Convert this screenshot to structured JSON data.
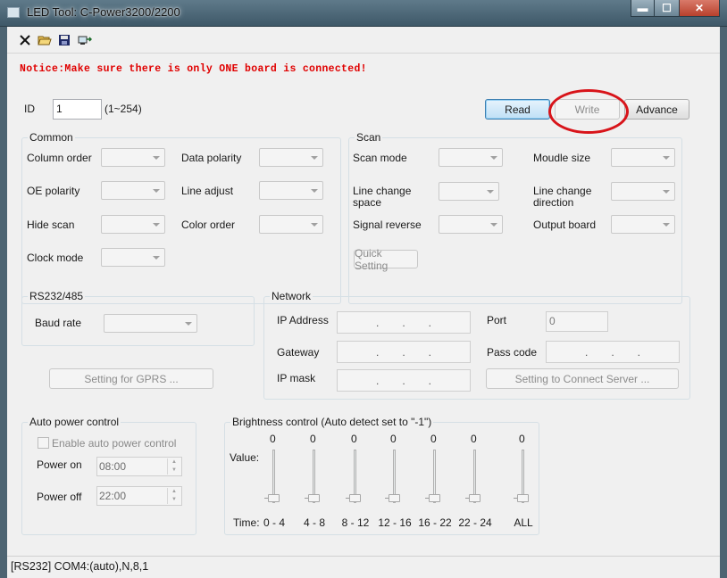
{
  "window": {
    "title": "LED Tool: C-Power3200/2200",
    "controls": {
      "minimize": "▬",
      "maximize": "☐",
      "close": "✕"
    }
  },
  "toolbar": {
    "icons": [
      "close-icon",
      "open-folder-icon",
      "save-icon",
      "connect-icon"
    ]
  },
  "notice": "Notice:Make sure there is only ONE board is connected!",
  "id_row": {
    "label": "ID",
    "value": "1",
    "range": "(1~254)"
  },
  "actions": {
    "read": "Read",
    "write": "Write",
    "advance": "Advance"
  },
  "common": {
    "title": "Common",
    "column_order": "Column order",
    "data_polarity": "Data polarity",
    "oe_polarity": "OE polarity",
    "line_adjust": "Line adjust",
    "hide_scan": "Hide scan",
    "color_order": "Color order",
    "clock_mode": "Clock mode"
  },
  "scan": {
    "title": "Scan",
    "scan_mode": "Scan mode",
    "moudle_size": "Moudle size",
    "line_change_space": "Line change space",
    "line_change_direction": "Line change direction",
    "signal_reverse": "Signal reverse",
    "output_board": "Output board",
    "quick_setting": "Quick Setting"
  },
  "rs232": {
    "title": "RS232/485",
    "baud_rate": "Baud rate",
    "gprs_button": "Setting for GPRS ..."
  },
  "network": {
    "title": "Network",
    "ip_address": "IP Address",
    "gateway": "Gateway",
    "ip_mask": "IP mask",
    "port_label": "Port",
    "port_value": "0",
    "pass_code": "Pass code",
    "connect_button": "Setting to Connect Server ..."
  },
  "auto_power": {
    "title": "Auto power control",
    "enable": "Enable auto power control",
    "power_on_label": "Power on",
    "power_on_value": "08:00",
    "power_off_label": "Power off",
    "power_off_value": "22:00"
  },
  "brightness": {
    "title": "Brightness control (Auto detect set to \"-1\")",
    "value_label": "Value:",
    "time_label": "Time:",
    "columns": [
      {
        "value": "0",
        "time": "0 - 4"
      },
      {
        "value": "0",
        "time": "4 - 8"
      },
      {
        "value": "0",
        "time": "8 - 12"
      },
      {
        "value": "0",
        "time": "12 - 16"
      },
      {
        "value": "0",
        "time": "16 - 22"
      },
      {
        "value": "0",
        "time": "22 - 24"
      },
      {
        "value": "0",
        "time": "ALL"
      }
    ]
  },
  "status_bar": "[RS232] COM4:(auto),N,8,1",
  "colors": {
    "notice": "#e00000",
    "highlight_circle": "#d8141a",
    "focus_button": "#3c7fb1"
  }
}
